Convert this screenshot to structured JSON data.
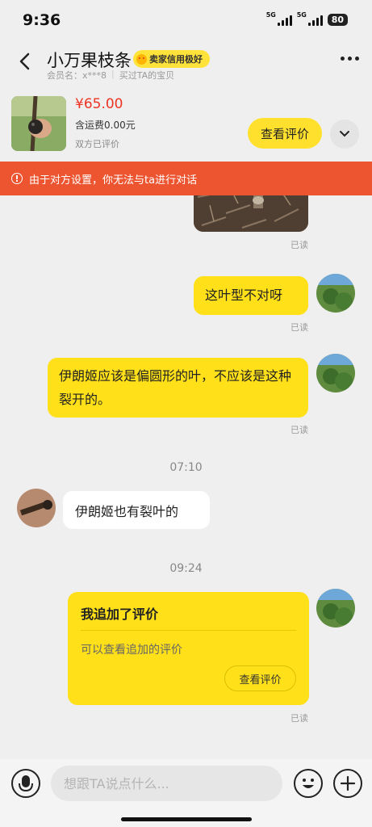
{
  "status_bar": {
    "time": "9:36",
    "signal1": "5G",
    "signal2": "5G",
    "battery": "80"
  },
  "header": {
    "title": "小万果枝条",
    "badge": "卖家信用极好",
    "member": "会员名：x***8",
    "bought": "买过TA的宝贝"
  },
  "product": {
    "price": "¥65.00",
    "shipping": "含运费0.00元",
    "rated": "双方已评价",
    "review_button": "查看评价"
  },
  "warning": "由于对方设置，你无法与ta进行对话",
  "messages": {
    "read_label": "已读",
    "msg1": "这叶型不对呀",
    "msg2": "伊朗姬应该是偏圆形的叶，不应该是这种裂开的。",
    "time1": "07:10",
    "msg3": "伊朗姬也有裂叶的",
    "time2": "09:24",
    "review_card": {
      "title": "我追加了评价",
      "subtitle": "可以查看追加的评价",
      "button": "查看评价"
    }
  },
  "input": {
    "placeholder": "想跟TA说点什么..."
  },
  "colors": {
    "accent_yellow": "#ffe019",
    "warning": "#ed5531",
    "price": "#ee3322"
  }
}
